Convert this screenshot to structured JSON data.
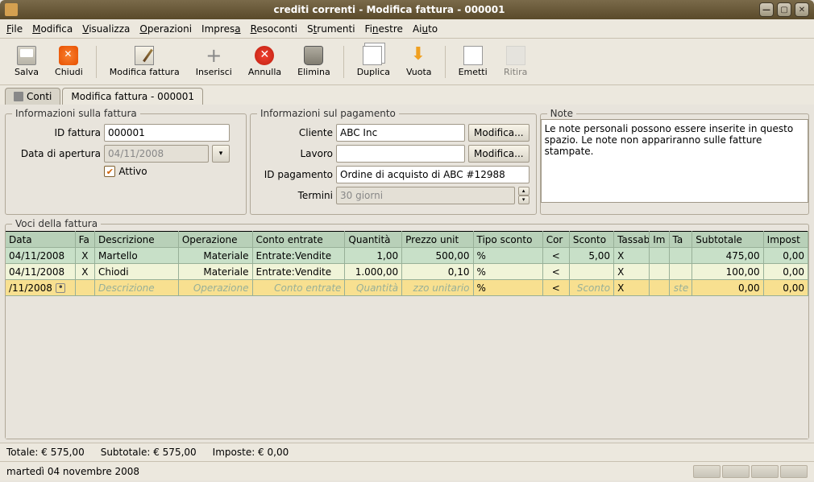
{
  "window": {
    "title": "crediti correnti - Modifica fattura - 000001"
  },
  "menubar": [
    "File",
    "Modifica",
    "Visualizza",
    "Operazioni",
    "Impresa",
    "Resoconti",
    "Strumenti",
    "Finestre",
    "Aiuto"
  ],
  "toolbar": [
    {
      "label": "Salva",
      "name": "save"
    },
    {
      "label": "Chiudi",
      "name": "close"
    },
    {
      "label": "Modifica fattura",
      "name": "edit"
    },
    {
      "label": "Inserisci",
      "name": "insert"
    },
    {
      "label": "Annulla",
      "name": "cancel"
    },
    {
      "label": "Elimina",
      "name": "delete"
    },
    {
      "label": "Duplica",
      "name": "dup"
    },
    {
      "label": "Vuota",
      "name": "empty"
    },
    {
      "label": "Emetti",
      "name": "emit"
    },
    {
      "label": "Ritira",
      "name": "ret"
    }
  ],
  "tabs": {
    "t0": "Conti",
    "t1": "Modifica fattura - 000001"
  },
  "groups": {
    "info_legend": "Informazioni sulla fattura",
    "pay_legend": "Informazioni sul pagamento",
    "note_legend": "Note",
    "voci_legend": "Voci della fattura"
  },
  "info": {
    "id_label": "ID fattura",
    "id_value": "000001",
    "date_label": "Data di apertura",
    "date_value": "04/11/2008",
    "active_label": "Attivo"
  },
  "pay": {
    "cliente_label": "Cliente",
    "cliente_value": "ABC Inc",
    "mod": "Modifica...",
    "lavoro_label": "Lavoro",
    "lavoro_value": "",
    "idpag_label": "ID pagamento",
    "idpag_value": "Ordine di acquisto di ABC #12988",
    "termini_label": "Termini",
    "termini_value": "30 giorni"
  },
  "note": {
    "text": "Le note personali possono essere inserite in questo spazio. Le note non appariranno sulle fatture stampate."
  },
  "headers": {
    "data": "Data",
    "fa": "Fa",
    "desc": "Descrizione",
    "op": "Operazione",
    "conto": "Conto entrate",
    "qt": "Quantità",
    "pu": "Prezzo unit",
    "ts": "Tipo sconto",
    "cor": "Cor",
    "sc": "Sconto",
    "tx": "Tassab",
    "im": "Im",
    "tat": "Ta",
    "sub": "Subtotale",
    "imp": "Impost"
  },
  "rows": [
    {
      "data": "04/11/2008",
      "fa": "X",
      "desc": "Martello",
      "op": "Materiale",
      "conto": "Entrate:Vendite",
      "qt": "1,00",
      "pu": "500,00",
      "ts": "%",
      "cor": "<",
      "sc": "5,00",
      "tx": "X",
      "im": "",
      "tat": "",
      "sub": "475,00",
      "imp": "0,00"
    },
    {
      "data": "04/11/2008",
      "fa": "X",
      "desc": "Chiodi",
      "op": "Materiale",
      "conto": "Entrate:Vendite",
      "qt": "1.000,00",
      "pu": "0,10",
      "ts": "%",
      "cor": "<",
      "sc": "",
      "tx": "X",
      "im": "",
      "tat": "",
      "sub": "100,00",
      "imp": "0,00"
    }
  ],
  "newrow": {
    "data": "/11/2008",
    "desc": "Descrizione",
    "op": "Operazione",
    "conto": "Conto entrate",
    "qt": "Quantità",
    "pu": "zzo unitario",
    "ts": "%",
    "cor": "<",
    "sc": "Sconto",
    "tx": "X",
    "tat": "ste",
    "sub": "0,00",
    "imp": "0,00"
  },
  "totals": {
    "tot": "Totale: € 575,00",
    "sub": "Subtotale: € 575,00",
    "imp": "Imposte: € 0,00"
  },
  "status": {
    "date": "martedì 04 novembre 2008"
  }
}
